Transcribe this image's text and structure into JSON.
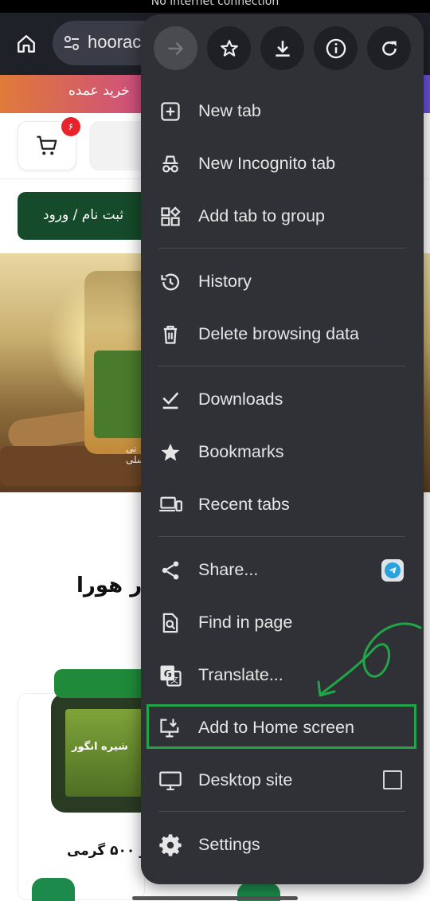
{
  "status_bar": {
    "text": "No internet connection"
  },
  "browser": {
    "url_text": "hoorac"
  },
  "page": {
    "banner_text": "خرید عمده",
    "cart_count": "۶",
    "login_label": "ثبت نام / ورود",
    "section_title": "ار هورا",
    "product_label_text": "شیره انگور",
    "product_name": "ور ۵۰۰ گرمی",
    "hero_jar_label": "نی عسلی"
  },
  "menu": {
    "top_icons": [
      "forward-icon",
      "bookmark-star-icon",
      "download-icon",
      "info-icon",
      "refresh-icon"
    ],
    "groups": [
      [
        {
          "label": "New tab",
          "icon": "new-tab-icon"
        },
        {
          "label": "New Incognito tab",
          "icon": "incognito-icon"
        },
        {
          "label": "Add tab to group",
          "icon": "tab-group-icon"
        }
      ],
      [
        {
          "label": "History",
          "icon": "history-icon"
        },
        {
          "label": "Delete browsing data",
          "icon": "trash-icon"
        }
      ],
      [
        {
          "label": "Downloads",
          "icon": "downloads-icon"
        },
        {
          "label": "Bookmarks",
          "icon": "bookmarks-icon"
        },
        {
          "label": "Recent tabs",
          "icon": "recent-tabs-icon"
        }
      ],
      [
        {
          "label": "Share...",
          "icon": "share-icon"
        },
        {
          "label": "Find in page",
          "icon": "find-in-page-icon"
        },
        {
          "label": "Translate...",
          "icon": "translate-icon"
        },
        {
          "label": "Add to Home screen",
          "icon": "add-to-home-icon"
        },
        {
          "label": "Desktop site",
          "icon": "desktop-icon",
          "checked": false
        }
      ],
      [
        {
          "label": "Settings",
          "icon": "settings-icon"
        }
      ]
    ]
  },
  "colors": {
    "menu_bg": "#303136",
    "highlight": "#22a548",
    "toolbar_bg": "#1f2128"
  }
}
